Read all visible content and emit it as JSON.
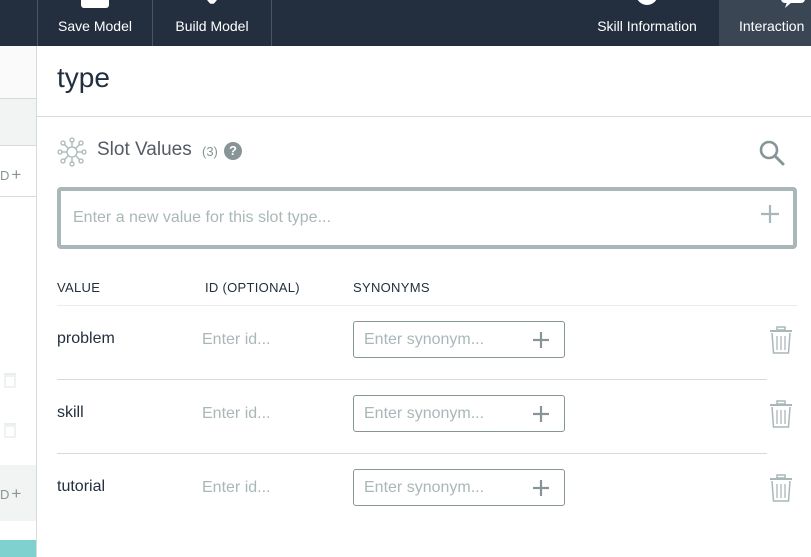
{
  "toolbar": {
    "save_label": "Save Model",
    "build_label": "Build Model",
    "skill_info_label": "Skill Information",
    "interaction_label": "Interaction"
  },
  "sidebar": {
    "add_label": "D"
  },
  "page": {
    "title": "type"
  },
  "slot_values": {
    "label": "Slot Values",
    "count": "(3)",
    "help": "?",
    "new_value_placeholder": "Enter a new value for this slot type..."
  },
  "table": {
    "headers": {
      "value": "VALUE",
      "id": "ID (OPTIONAL)",
      "synonyms": "SYNONYMS"
    },
    "id_placeholder": "Enter id...",
    "synonym_placeholder": "Enter synonym...",
    "rows": [
      {
        "value": "problem"
      },
      {
        "value": "skill"
      },
      {
        "value": "tutorial"
      }
    ]
  },
  "colors": {
    "topbar": "#232f3e",
    "active_tab": "#3b4654",
    "border": "#aab7b8",
    "muted_text": "#879596",
    "accent_teal": "#7fd1cf"
  }
}
